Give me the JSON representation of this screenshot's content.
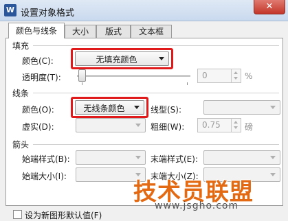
{
  "window": {
    "title": "设置对象格式",
    "app_icon": "W",
    "close_glyph": "✕"
  },
  "tabs": [
    {
      "label": "颜色与线条"
    },
    {
      "label": "大小"
    },
    {
      "label": "版式"
    },
    {
      "label": "文本框"
    }
  ],
  "fill": {
    "section_label": "填充",
    "color_label": "颜色(C):",
    "color_value": "无填充颜色",
    "transparency_label": "透明度(T):",
    "transparency_value": "0",
    "percent_sign": "%",
    "transparency_level": 0
  },
  "line": {
    "section_label": "线条",
    "color_label": "颜色(O):",
    "color_value": "无线条颜色",
    "style_label": "线型(S):",
    "dash_label": "虚实(D):",
    "weight_label": "粗细(W):",
    "weight_value": "0.75",
    "weight_unit": "磅"
  },
  "arrows": {
    "section_label": "箭头",
    "begin_style_label": "始端样式(B):",
    "end_style_label": "末端样式(E):",
    "begin_size_label": "始端大小(I):",
    "end_size_label": "末端大小(Z):"
  },
  "default_checkbox": {
    "label": "设为新图形默认值(F)",
    "checked": false
  },
  "watermark": {
    "main": "技术员联盟",
    "sub": "www.jsgho.com"
  },
  "colors": {
    "highlight": "#e01a1a",
    "watermark": "#e36a12"
  }
}
